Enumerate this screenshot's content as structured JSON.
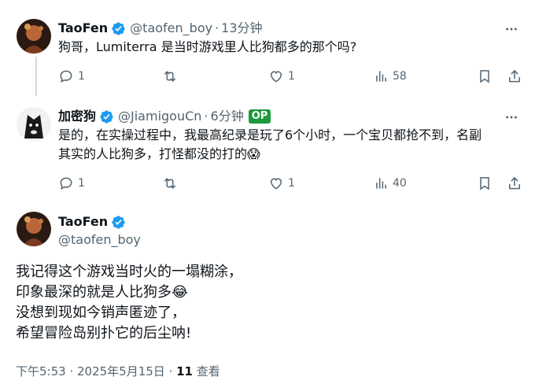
{
  "reply1": {
    "name": "TaoFen",
    "handle": "@taofen_boy",
    "separator": "·",
    "time": "13分钟",
    "text": "狗哥，Lumiterra 是当时游戏里人比狗都多的那个吗?",
    "reply_count": "1",
    "retweet_count": "",
    "like_count": "1",
    "view_count": "58"
  },
  "reply2": {
    "name": "加密狗",
    "handle": "@JiamigouCn",
    "separator": "·",
    "time": "6分钟",
    "badge": "OP",
    "text_lines": [
      "是的，在实操过程中，我最高纪录是玩了6个小时，一个宝贝都抢不到，名副",
      "其实的人比狗多，打怪都没的打的😱"
    ],
    "reply_count": "1",
    "retweet_count": "",
    "like_count": "1",
    "view_count": "40"
  },
  "main": {
    "name": "TaoFen",
    "handle": "@taofen_boy",
    "lines": [
      "我记得这个游戏当时火的一塌糊涂，",
      "印象最深的就是人比狗多😂",
      "没想到现如今销声匿迹了，",
      "希望冒险岛别扑它的后尘呐!"
    ],
    "timestamp": "下午5:53 · 2025年5月15日 · ",
    "views_count": "11",
    "views_label": " 查看"
  },
  "colors": {
    "verified": "#1d9bf0",
    "muted": "#536471",
    "op_badge": "#1d9a3c"
  }
}
